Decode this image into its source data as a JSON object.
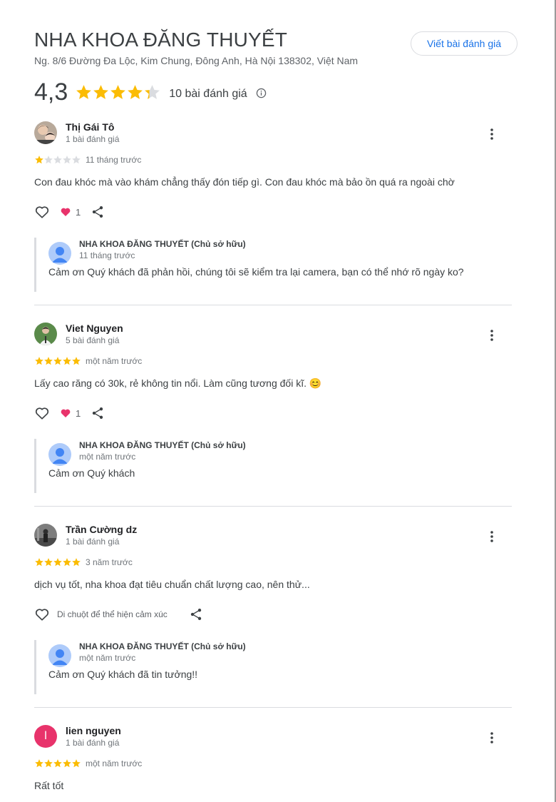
{
  "business": {
    "name": "NHA KHOA ĐĂNG THUYẾT",
    "address": "Ng. 8/6 Đường Đa Lộc, Kim Chung, Đông Anh, Hà Nội 138302, Việt Nam",
    "write_review_label": "Viết bài đánh giá",
    "rating": "4,3",
    "rating_value": 4.3,
    "review_count_label": "10 bài đánh giá"
  },
  "colors": {
    "star": "#fbbc04",
    "star_empty": "#dadce0",
    "link": "#1a73e8",
    "heart_reaction": "#e8336b"
  },
  "reviews": [
    {
      "author": "Thị Gái Tô",
      "author_meta": "1 bài đánh giá",
      "stars": 1,
      "time": "11 tháng trước",
      "text": "Con đau khóc mà vào khám chẳng thấy đón tiếp gì. Con đau khóc mà bảo ồn quá ra ngoài chờ",
      "reaction_count": "1",
      "reply": {
        "owner": "NHA KHOA ĐĂNG THUYẾT (Chủ sở hữu)",
        "time": "11 tháng trước",
        "text": "Cảm ơn Quý khách đã phản hồi, chúng tôi sẽ kiểm tra lại camera, bạn có thể nhớ rõ ngày ko?"
      }
    },
    {
      "author": "Viet Nguyen",
      "author_meta": "5 bài đánh giá",
      "stars": 5,
      "time": "một năm trước",
      "text": "Lấy cao răng có 30k, rẻ không tin nổi. Làm cũng tương đối kĩ. 😊",
      "reaction_count": "1",
      "reply": {
        "owner": "NHA KHOA ĐĂNG THUYẾT (Chủ sở hữu)",
        "time": "một năm trước",
        "text": "Cảm ơn Quý khách"
      }
    },
    {
      "author": "Trần Cường dz",
      "author_meta": "1 bài đánh giá",
      "stars": 5,
      "time": "3 năm trước",
      "text": "dịch vụ tốt, nha khoa đạt tiêu chuẩn chất lượng cao, nên thử...",
      "hover_hint": "Di chuột để thể hiện cảm xúc",
      "reply": {
        "owner": "NHA KHOA ĐĂNG THUYẾT (Chủ sở hữu)",
        "time": "một năm trước",
        "text": "Cảm ơn Quý khách đã tin tưởng!!"
      }
    },
    {
      "author": "lien nguyen",
      "author_initial": "l",
      "author_meta": "1 bài đánh giá",
      "stars": 5,
      "time": "một năm trước",
      "text": "Rất tốt"
    }
  ]
}
